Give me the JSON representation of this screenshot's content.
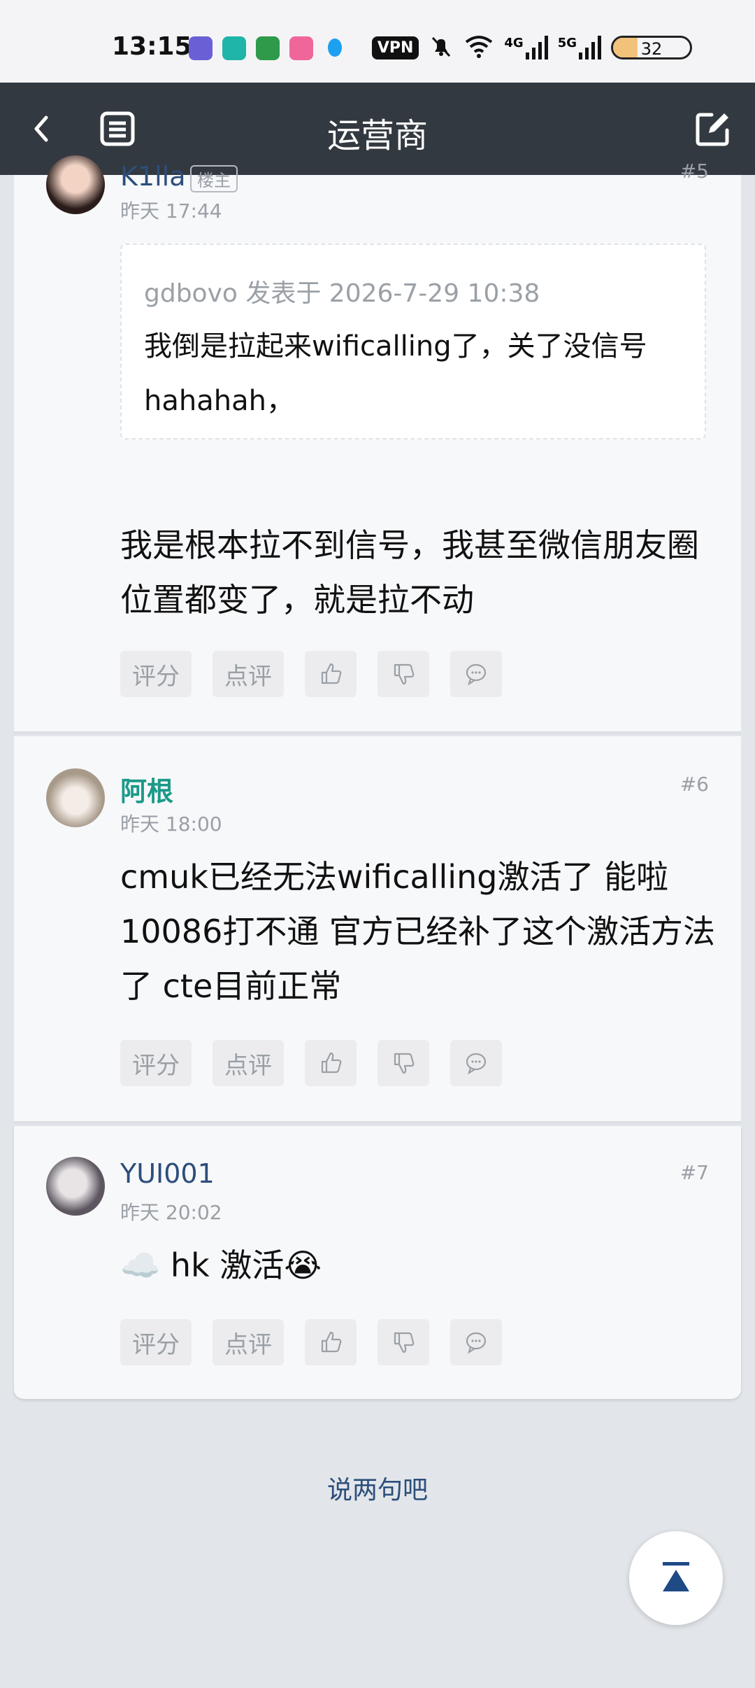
{
  "status_bar": {
    "time": "13:15",
    "vpn": "VPN",
    "net1": "4G",
    "net2": "5G",
    "battery": "32",
    "battery_level": 0.32
  },
  "header": {
    "title": "运营商",
    "back_icon": "chevron-left-icon",
    "list_icon": "list-icon",
    "edit_icon": "edit-icon"
  },
  "posts": [
    {
      "author": "K1lla",
      "badge": "楼主",
      "time": "昨天 17:44",
      "floor": "#5",
      "quote": {
        "header": "gdbovo 发表于 2026-7-29 10:38",
        "text": "我倒是拉起来wificalling了，关了没信号hahahah，"
      },
      "content": "我是根本拉不到信号，我甚至微信朋友圈位置都变了，就是拉不动"
    },
    {
      "author": "阿根",
      "time": "昨天 18:00",
      "floor": "#6",
      "content": "cmuk已经无法wificalling激活了 能啦10086打不通 官方已经补了这个激活方法了 cte目前正常"
    },
    {
      "author": "YUI001",
      "time": "昨天 20:02",
      "floor": "#7",
      "content": "☁️ hk 激活😭"
    }
  ],
  "actions": {
    "rate": "评分",
    "comment": "点评"
  },
  "reply_link": "说两句吧",
  "colors": {
    "header_bg": "#333940",
    "link_blue": "#2c4e7a",
    "author_green": "#1b9a89"
  }
}
